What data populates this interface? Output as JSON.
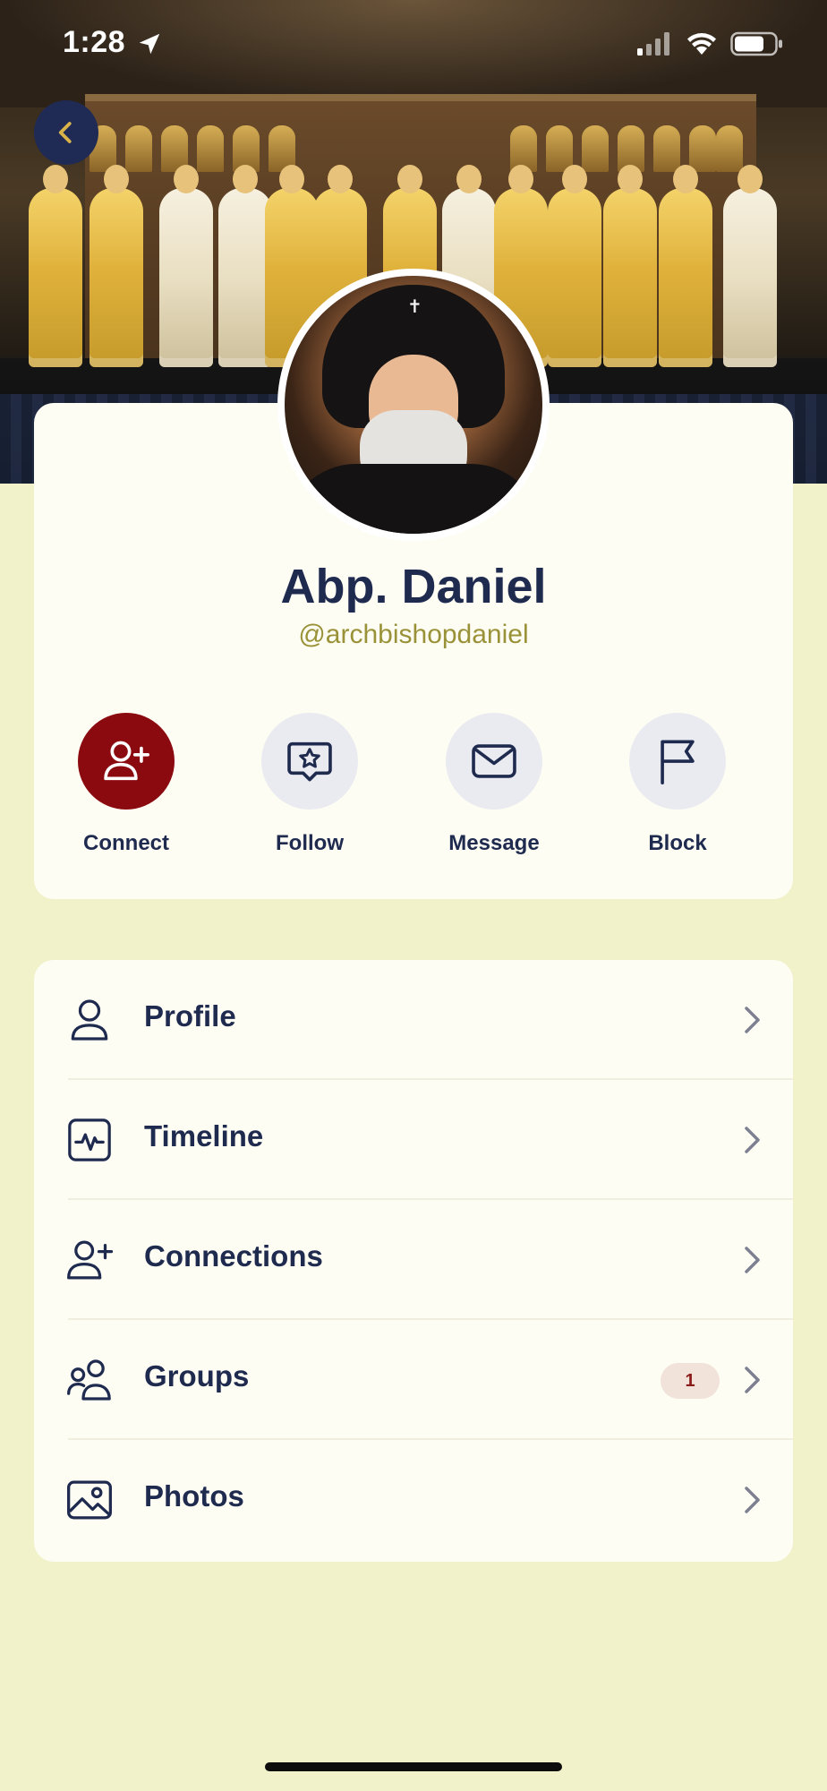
{
  "status_bar": {
    "time": "1:28"
  },
  "profile": {
    "name": "Abp. Daniel",
    "handle": "@archbishopdaniel"
  },
  "actions": [
    {
      "label": "Connect",
      "icon": "add-user-icon"
    },
    {
      "label": "Follow",
      "icon": "star-message-icon"
    },
    {
      "label": "Message",
      "icon": "envelope-icon"
    },
    {
      "label": "Block",
      "icon": "flag-icon"
    }
  ],
  "menu": [
    {
      "label": "Profile",
      "icon": "person-icon"
    },
    {
      "label": "Timeline",
      "icon": "activity-icon"
    },
    {
      "label": "Connections",
      "icon": "add-user-icon"
    },
    {
      "label": "Groups",
      "icon": "group-icon",
      "badge": "1"
    },
    {
      "label": "Photos",
      "icon": "image-icon"
    }
  ],
  "colors": {
    "background": "#f1f1ca",
    "card": "#fefdf4",
    "primary_text": "#1f2a4f",
    "handle_text": "#9a9238",
    "connect_button": "#8b0a0f",
    "back_button": "#1f2a55",
    "badge_bg": "#f1e3da",
    "badge_text": "#8b1a1a"
  }
}
